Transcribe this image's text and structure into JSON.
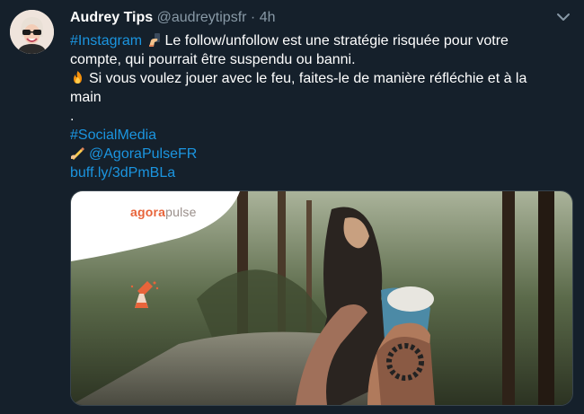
{
  "tweet": {
    "author_name": "Audrey Tips",
    "author_handle": "@audreytipsfr",
    "separator": "·",
    "time": "4h",
    "hashtag_instagram": "#Instagram",
    "text_line1": "Le follow/unfollow est une stratégie risquée pour votre",
    "text_line2": "compte, qui pourrait être suspendu ou banni.",
    "text_line3": "Si vous voulez jouer avec le feu, faites-le de manière réfléchie et à la",
    "text_line4": "main",
    "text_dot": ".",
    "hashtag_socialmedia": "#SocialMedia",
    "mention": "@AgoraPulseFR",
    "short_link": "buff.ly/3dPmBLa"
  },
  "card": {
    "brand_agora": "agora",
    "brand_pulse": "pulse"
  },
  "icons": {
    "avatar": "avatar-icon",
    "menu": "chevron-down-icon",
    "selfie": "selfie-emoji-icon",
    "fire": "fire-emoji-icon",
    "writing": "writing-hand-emoji-icon",
    "lab": "pipette-flask-icon"
  },
  "colors": {
    "background": "#15202b",
    "link": "#1b95e0",
    "muted": "#8899a6",
    "border": "#38444d",
    "brand_orange": "#e8643a"
  }
}
